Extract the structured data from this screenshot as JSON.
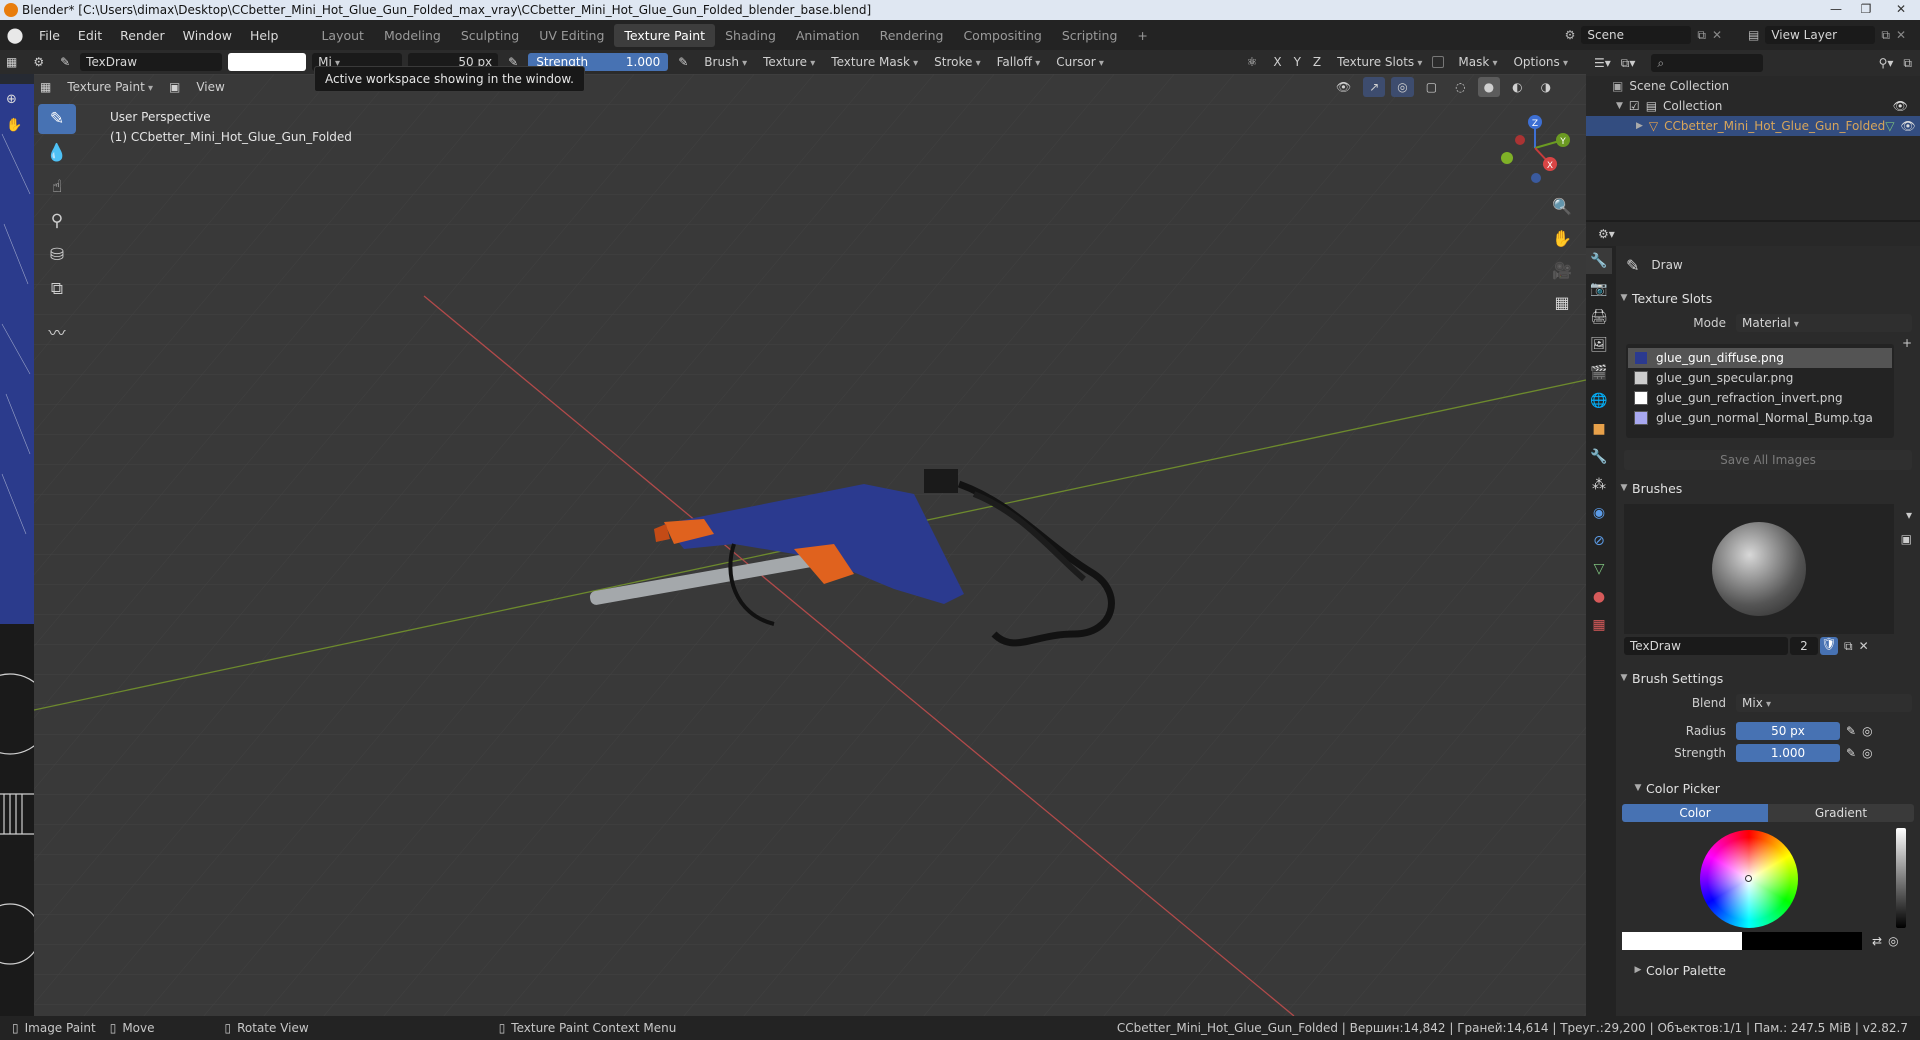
{
  "window": {
    "title": "Blender* [C:\\Users\\dimax\\Desktop\\CCbetter_Mini_Hot_Glue_Gun_Folded_max_vray\\CCbetter_Mini_Hot_Glue_Gun_Folded_blender_base.blend]"
  },
  "menu": [
    "File",
    "Edit",
    "Render",
    "Window",
    "Help"
  ],
  "workspaces": {
    "tabs": [
      "Layout",
      "Modeling",
      "Sculpting",
      "UV Editing",
      "Texture Paint",
      "Shading",
      "Animation",
      "Rendering",
      "Compositing",
      "Scripting"
    ],
    "active": "Texture Paint",
    "add": "+"
  },
  "scene": {
    "label": "Scene",
    "view_layer": "View Layer"
  },
  "toolheader": {
    "brush_name": "TexDraw",
    "blend_short": "Mi",
    "radius": "50 px",
    "strength_label": "Strength",
    "strength_value": "1.000",
    "menus": [
      "Brush",
      "Texture",
      "Texture Mask",
      "Stroke",
      "Falloff",
      "Cursor"
    ],
    "axes": [
      "X",
      "Y",
      "Z"
    ],
    "texture_slots": "Texture Slots",
    "mask": "Mask",
    "options": "Options"
  },
  "tooltip": "Active workspace showing in the window.",
  "viewport": {
    "mode": "Texture Paint",
    "view_menu": "View",
    "perspective": "User Perspective",
    "object": "(1) CCbetter_Mini_Hot_Glue_Gun_Folded",
    "gizmo": {
      "x": "X",
      "y": "Y",
      "z": "Z"
    }
  },
  "outliner": {
    "scene_collection": "Scene Collection",
    "collection": "Collection",
    "object": "CCbetter_Mini_Hot_Glue_Gun_Folded"
  },
  "properties": {
    "tool_name": "Draw",
    "texture_slots": {
      "header": "Texture Slots",
      "mode_label": "Mode",
      "mode_value": "Material",
      "slots": [
        "glue_gun_diffuse.png",
        "glue_gun_specular.png",
        "glue_gun_refraction_invert.png",
        "glue_gun_normal_Normal_Bump.tga"
      ],
      "save_all": "Save All Images"
    },
    "brushes": {
      "header": "Brushes",
      "name": "TexDraw",
      "users": "2"
    },
    "brush_settings": {
      "header": "Brush Settings",
      "blend_label": "Blend",
      "blend_value": "Mix",
      "radius_label": "Radius",
      "radius_value": "50 px",
      "strength_label": "Strength",
      "strength_value": "1.000"
    },
    "color_picker": {
      "header": "Color Picker",
      "tab_color": "Color",
      "tab_gradient": "Gradient"
    },
    "color_palette": "Color Palette"
  },
  "statusbar": {
    "left": [
      "Image Paint",
      "Move",
      "Rotate View",
      "Texture Paint Context Menu"
    ],
    "right": "CCbetter_Mini_Hot_Glue_Gun_Folded | Вершин:14,842 | Граней:14,614 | Треуг.:29,200 | Объектов:1/1 | Пам.: 247.5 MiB | v2.82.7"
  },
  "colors": {
    "accent": "#4772b3",
    "bg": "#3a3a3a",
    "panel": "#2b2b2b"
  }
}
